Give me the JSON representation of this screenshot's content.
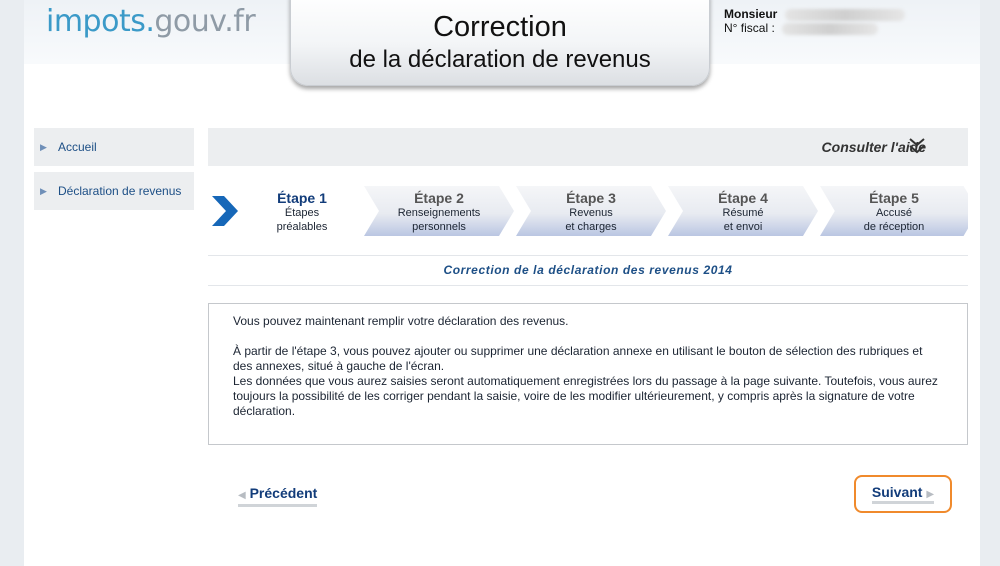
{
  "header": {
    "logo_part1": "impots.",
    "logo_part2": "gouv",
    "logo_part3": ".fr",
    "title_line1": "Correction",
    "title_line2": "de la déclaration de revenus",
    "user_salutation": "Monsieur",
    "fiscal_label": "N° fiscal :"
  },
  "sidebar": {
    "items": [
      {
        "label": "Accueil"
      },
      {
        "label": "Déclaration de revenus"
      }
    ]
  },
  "help": {
    "label": "Consulter l'aide",
    "icon": "double-chevron-down-icon"
  },
  "steps": [
    {
      "label": "Étape 1",
      "line1": "Étapes",
      "line2": "préalables",
      "state": "current"
    },
    {
      "label": "Étape 2",
      "line1": "Renseignements",
      "line2": "personnels",
      "state": "upcoming"
    },
    {
      "label": "Étape 3",
      "line1": "Revenus",
      "line2": "et charges",
      "state": "upcoming"
    },
    {
      "label": "Étape 4",
      "line1": "Résumé",
      "line2": "et envoi",
      "state": "upcoming"
    },
    {
      "label": "Étape 5",
      "line1": "Accusé",
      "line2": "de réception",
      "state": "upcoming"
    }
  ],
  "section_title": "Correction de la déclaration des revenus 2014",
  "info": {
    "p1": "Vous pouvez maintenant remplir votre déclaration des revenus.",
    "p2": "À partir de l'étape 3, vous pouvez ajouter ou supprimer une déclaration annexe en utilisant le bouton de sélection des rubriques et des annexes, situé à gauche de l'écran.",
    "p3": "Les données que vous aurez saisies seront automatiquement enregistrées lors du passage à la page suivante. Toutefois, vous aurez toujours la possibilité de les corriger pendant la saisie, voire de les modifier ultérieurement, y compris après la signature de votre déclaration."
  },
  "nav": {
    "prev_label": "Précédent",
    "next_label": "Suivant"
  },
  "colors": {
    "accent_blue": "#123c7a",
    "link_blue": "#1d4f86",
    "logo_blue": "#3b9ac8",
    "highlight_orange": "#f08a2c"
  }
}
